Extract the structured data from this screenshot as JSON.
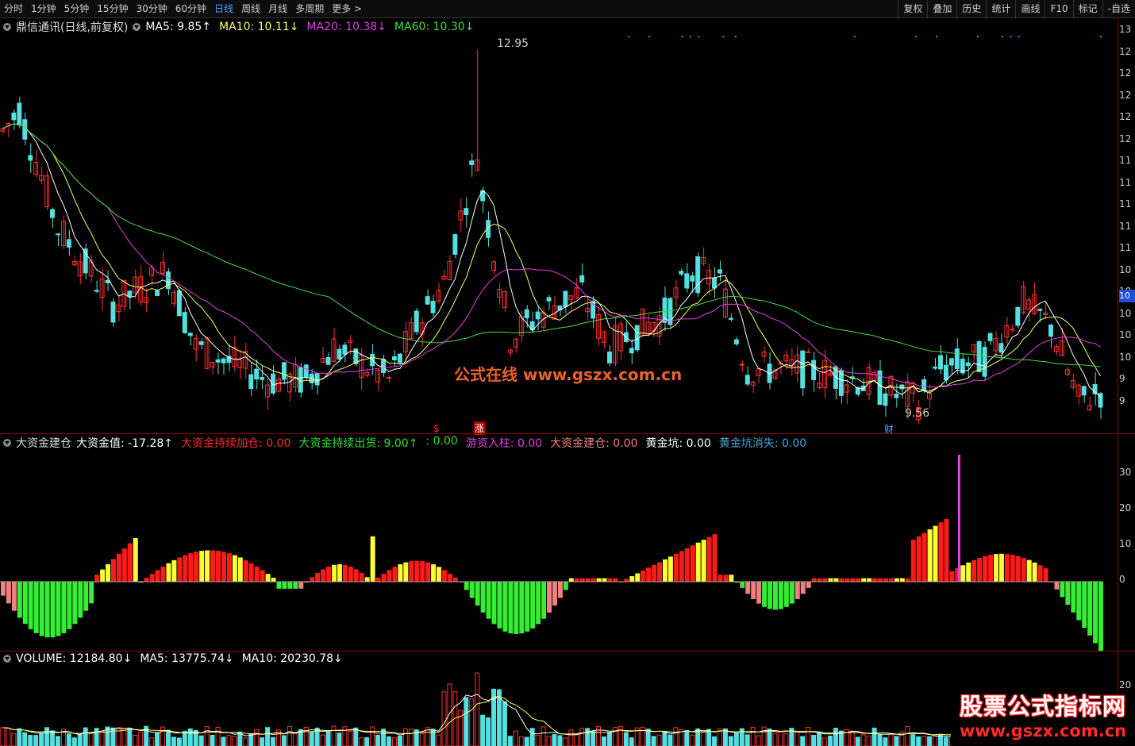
{
  "toolbar": {
    "periods": [
      "分时",
      "1分钟",
      "5分钟",
      "15分钟",
      "30分钟",
      "60分钟",
      "日线",
      "周线",
      "月线",
      "多周期",
      "更多 >"
    ],
    "active_period": "日线",
    "right_tools": [
      "复权",
      "叠加",
      "历史",
      "统计",
      "画线",
      "F10",
      "标记",
      "-自选"
    ]
  },
  "main": {
    "title": "鼎信通讯(日线,前复权)",
    "ma": [
      {
        "label": "MA5: 9.85↑",
        "color": "#ffffff"
      },
      {
        "label": "MA10: 10.11↓",
        "color": "#ffff66"
      },
      {
        "label": "MA20: 10.38↓",
        "color": "#e040e0"
      },
      {
        "label": "MA60: 10.30↓",
        "color": "#44dd44"
      }
    ],
    "high_label": "12.95",
    "low_label": "9.56",
    "marker_s": "$",
    "marker_zhang": "涨",
    "marker_cai": "财",
    "yaxis_ticks": [
      "13",
      "12",
      "12",
      "12",
      "12",
      "12",
      "11",
      "11",
      "11",
      "11",
      "11",
      "10",
      "10",
      "10",
      "10",
      "10",
      "9",
      "9"
    ],
    "last_price": "10"
  },
  "watermark": "公式在线  www.gszx.com.cn",
  "indicator": {
    "name": "大资金建仓",
    "fields": [
      {
        "label": "大资金值: -17.28↑",
        "color": "#ffffff"
      },
      {
        "label": "大资金持续加仓: 0.00",
        "color": "#ff2a2a"
      },
      {
        "label": "大资金持续出货: 9.00↑",
        "color": "#33dd33"
      },
      {
        "label": ": 0.00",
        "color": "#33dd33"
      },
      {
        "label": "游资入柱: 0.00",
        "color": "#e040e0"
      },
      {
        "label": "大资金建仓: 0.00",
        "color": "#f08080"
      },
      {
        "label": "黄金坑: 0.00",
        "color": "#ffffff"
      },
      {
        "label": "黄金坑消失: 0.00",
        "color": "#4fa3d9"
      }
    ],
    "yaxis_ticks": [
      "30",
      "20",
      "10",
      "0"
    ]
  },
  "volume": {
    "fields": [
      {
        "label": "VOLUME: 12184.80↓",
        "color": "#ffffff"
      },
      {
        "label": "MA5: 13775.74↓",
        "color": "#ffffff"
      },
      {
        "label": "MA10: 20230.78↓",
        "color": "#ffffff"
      }
    ],
    "yaxis_ticks": [
      "20"
    ]
  },
  "brand": {
    "line1": "股票公式指标网",
    "line2": "www.gszx.com.cn"
  },
  "colors": {
    "up": "#ff3030",
    "down": "#54e0e0",
    "ma5": "#ffffff",
    "ma10": "#ffff66",
    "ma20": "#e040e0",
    "ma60": "#44dd44"
  }
}
